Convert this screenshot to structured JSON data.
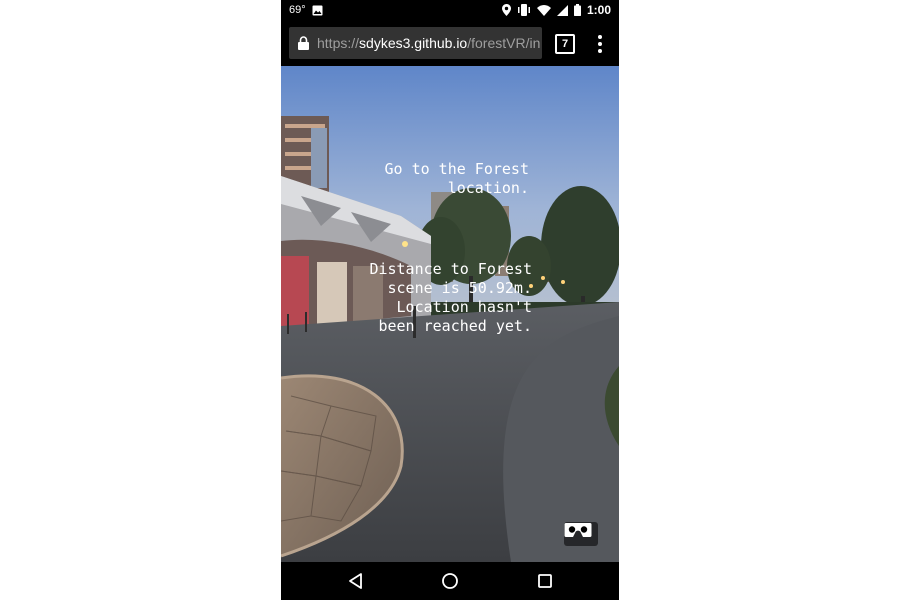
{
  "status_bar": {
    "temperature": "69°",
    "time": "1:00",
    "icons": [
      "image-icon",
      "location-icon",
      "vibrate-icon",
      "wifi-icon",
      "signal-icon",
      "battery-icon"
    ]
  },
  "browser": {
    "url_scheme": "https://",
    "url_host": "sdykes3.github.io",
    "url_path": "/forestVR/in",
    "tab_count": "7",
    "icons": [
      "lock-icon",
      "more-vert-icon"
    ]
  },
  "scene": {
    "message_goal": "Go to the Forest\nlocation.",
    "message_status": "Distance to Forest\nscene is 50.92m.\nLocation hasn't\nbeen reached yet.",
    "vr_button_icon": "cardboard-vr-icon"
  },
  "nav_bar": {
    "icons": [
      "back-icon",
      "home-icon",
      "recents-icon"
    ]
  },
  "colors": {
    "bars": "#000000",
    "url_bar": "#333333",
    "url_muted": "#9e9e9e",
    "sky": "#7f9ccc"
  }
}
